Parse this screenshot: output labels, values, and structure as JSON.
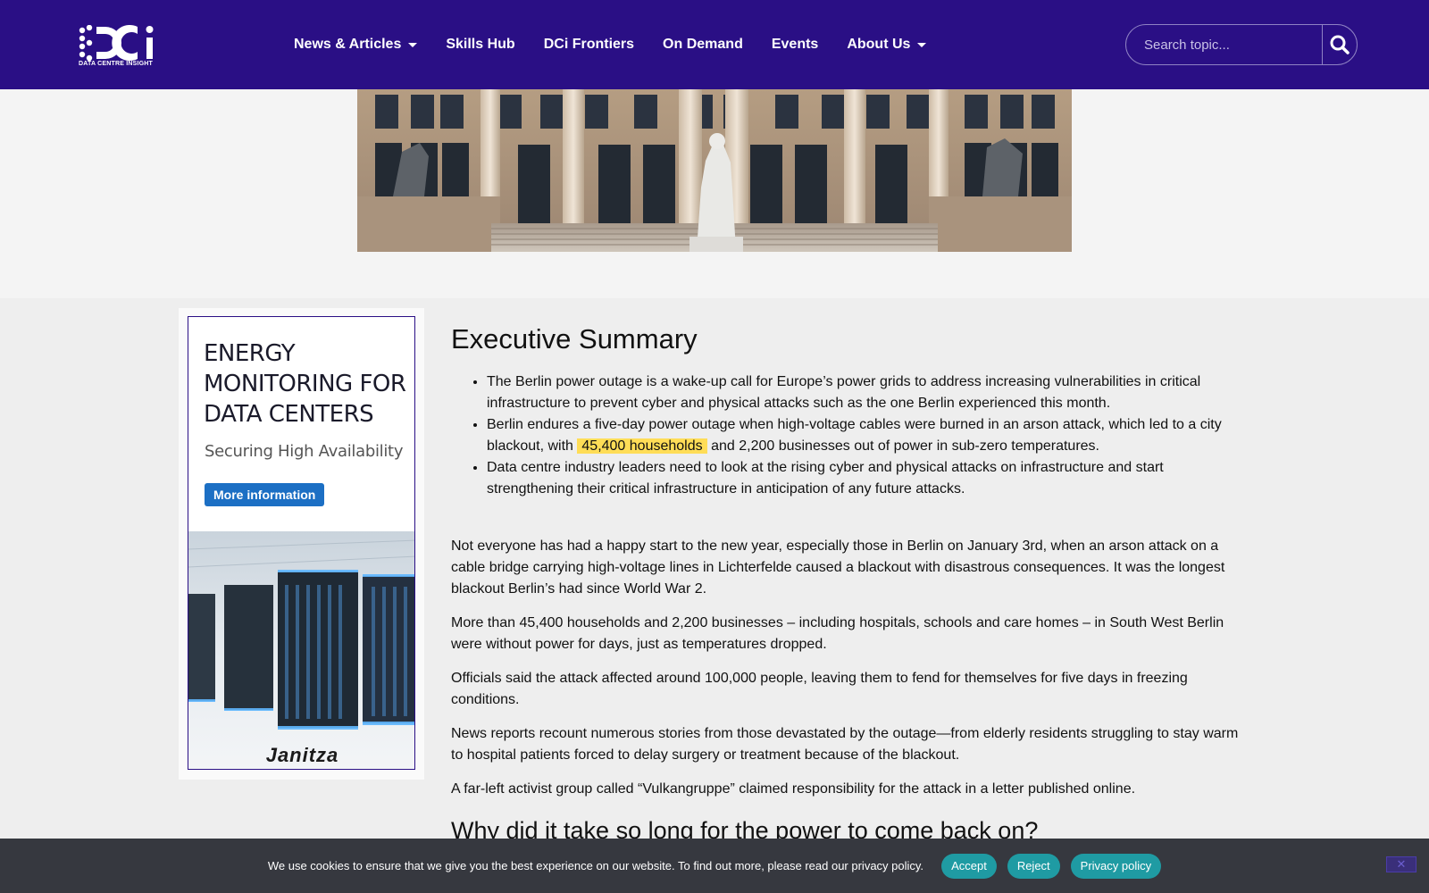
{
  "header": {
    "logo_sub": "DATA CENTRE INSIGHT",
    "nav": [
      {
        "label": "News & Articles",
        "dropdown": true
      },
      {
        "label": "Skills Hub",
        "dropdown": false
      },
      {
        "label": "DCi Frontiers",
        "dropdown": false
      },
      {
        "label": "On Demand",
        "dropdown": false
      },
      {
        "label": "Events",
        "dropdown": false
      },
      {
        "label": "About Us",
        "dropdown": true
      }
    ],
    "search_placeholder": "Search topic...",
    "search_icon": "search-icon",
    "brand_color": "#2a0f85"
  },
  "ad": {
    "title": "ENERGY MONITORING FOR DATA CENTERS",
    "subtitle": "Securing High Availability",
    "button": "More information",
    "brand": "Janitza"
  },
  "article": {
    "heading": "Executive Summary",
    "bullet1": "The Berlin power outage is a wake-up call for Europe’s power grids to address increasing vulnerabilities in critical infrastructure to prevent cyber and physical attacks such as the one Berlin experienced this month.",
    "bullet2_pre": "Berlin endures a five-day power outage when high-voltage cables were burned in an arson attack, which led to a city blackout, with",
    "bullet2_hl": "45,400 households",
    "bullet2_post": "and 2,200 businesses out of power in sub-zero temperatures.",
    "bullet3": "Data centre industry leaders need to look at the rising cyber and physical attacks on infrastructure and start strengthening their critical infrastructure in anticipation of any future attacks.",
    "p1": "Not everyone has had a happy start to the new year, especially those in Berlin on January 3rd, when an arson attack on a cable bridge carrying high-voltage lines in Lichterfelde caused a blackout with disastrous consequences. It was the longest blackout Berlin’s had since World War 2.",
    "p2": "More than 45,400 households and 2,200 businesses – including hospitals, schools and care homes – in South West Berlin were without power for days, just as temperatures dropped.",
    "p3": "Officials said the attack affected around 100,000 people, leaving them to fend for themselves for five days in freezing conditions.",
    "p4": "News reports recount numerous stories from those devastated by the outage—from elderly residents struggling to stay warm to hospital patients forced to delay surgery or treatment because of the blackout.",
    "p5": "A far-left activist group called “Vulkangruppe” claimed responsibility for the attack in a letter published online.",
    "heading2": "Why did it take so long for the power to come back on?"
  },
  "cookie": {
    "text": "We use cookies to ensure that we give you the best experience on our website. To find out more, please read our privacy policy.",
    "accept": "Accept",
    "reject": "Reject",
    "privacy": "Privacy policy",
    "close": "✕"
  }
}
